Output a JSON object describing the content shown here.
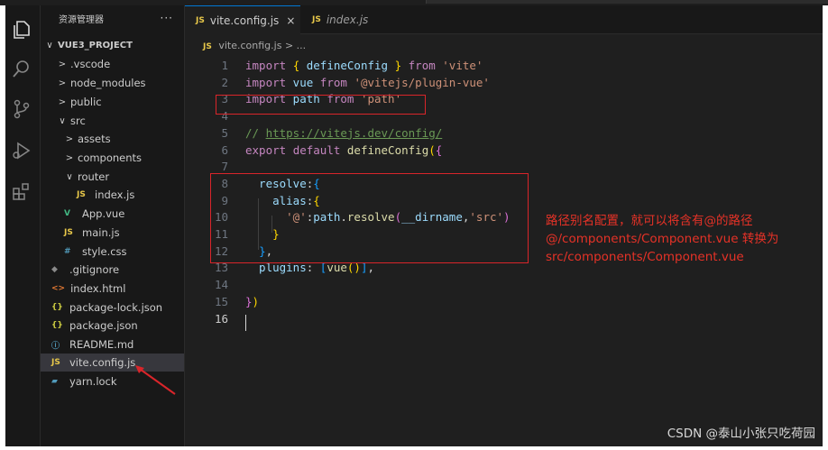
{
  "sidebar": {
    "title": "资源管理器",
    "more": "···",
    "items": [
      {
        "label": "VUE3_PROJECT",
        "chevron": "∨",
        "icon": ""
      },
      {
        "label": ".vscode",
        "chevron": ">",
        "icon": ""
      },
      {
        "label": "node_modules",
        "chevron": ">",
        "icon": ""
      },
      {
        "label": "public",
        "chevron": ">",
        "icon": ""
      },
      {
        "label": "src",
        "chevron": "∨",
        "icon": ""
      },
      {
        "label": "assets",
        "chevron": ">",
        "icon": ""
      },
      {
        "label": "components",
        "chevron": ">",
        "icon": ""
      },
      {
        "label": "router",
        "chevron": "∨",
        "icon": ""
      },
      {
        "label": "index.js",
        "chevron": "",
        "icon": "JS"
      },
      {
        "label": "App.vue",
        "chevron": "",
        "icon": "V"
      },
      {
        "label": "main.js",
        "chevron": "",
        "icon": "JS"
      },
      {
        "label": "style.css",
        "chevron": "",
        "icon": "#"
      },
      {
        "label": ".gitignore",
        "chevron": "",
        "icon": "◆"
      },
      {
        "label": "index.html",
        "chevron": "",
        "icon": "<>"
      },
      {
        "label": "package-lock.json",
        "chevron": "",
        "icon": "{}"
      },
      {
        "label": "package.json",
        "chevron": "",
        "icon": "{}"
      },
      {
        "label": "README.md",
        "chevron": "",
        "icon": "ⓘ"
      },
      {
        "label": "vite.config.js",
        "chevron": "",
        "icon": "JS"
      },
      {
        "label": "yarn.lock",
        "chevron": "",
        "icon": "▰"
      }
    ]
  },
  "tabs": [
    {
      "icon": "JS",
      "label": "vite.config.js",
      "close": "×"
    },
    {
      "icon": "JS",
      "label": "index.js"
    }
  ],
  "breadcrumb": {
    "icon": "JS",
    "file": "vite.config.js",
    "sep": "> ..."
  },
  "code_lines": [
    {
      "n": "1",
      "tokens": [
        {
          "t": "import",
          "c": "kw"
        },
        {
          "t": " ",
          "c": "punc"
        },
        {
          "t": "{",
          "c": "br1"
        },
        {
          "t": " defineConfig ",
          "c": "id"
        },
        {
          "t": "}",
          "c": "br1"
        },
        {
          "t": " ",
          "c": "punc"
        },
        {
          "t": "from",
          "c": "kw"
        },
        {
          "t": " ",
          "c": "punc"
        },
        {
          "t": "'vite'",
          "c": "str"
        }
      ]
    },
    {
      "n": "2",
      "tokens": [
        {
          "t": "import",
          "c": "kw"
        },
        {
          "t": " vue ",
          "c": "id"
        },
        {
          "t": "from",
          "c": "kw"
        },
        {
          "t": " ",
          "c": "punc"
        },
        {
          "t": "'@vitejs/plugin-vue'",
          "c": "str"
        }
      ]
    },
    {
      "n": "3",
      "tokens": [
        {
          "t": "import",
          "c": "kw"
        },
        {
          "t": " path ",
          "c": "id"
        },
        {
          "t": "from",
          "c": "kw"
        },
        {
          "t": " ",
          "c": "punc"
        },
        {
          "t": "'path'",
          "c": "str"
        }
      ]
    },
    {
      "n": "4",
      "tokens": []
    },
    {
      "n": "5",
      "tokens": [
        {
          "t": "// ",
          "c": "cmt"
        },
        {
          "t": "https://vitejs.dev/config/",
          "c": "link"
        }
      ]
    },
    {
      "n": "6",
      "tokens": [
        {
          "t": "export",
          "c": "kw"
        },
        {
          "t": " ",
          "c": "punc"
        },
        {
          "t": "default",
          "c": "kw"
        },
        {
          "t": " ",
          "c": "punc"
        },
        {
          "t": "defineConfig",
          "c": "fn"
        },
        {
          "t": "(",
          "c": "br1"
        },
        {
          "t": "{",
          "c": "br2"
        }
      ]
    },
    {
      "n": "7",
      "tokens": []
    },
    {
      "n": "8",
      "tokens": [
        {
          "t": "  resolve",
          "c": "id"
        },
        {
          "t": ":",
          "c": "punc"
        },
        {
          "t": "{",
          "c": "br3"
        }
      ]
    },
    {
      "n": "9",
      "tokens": [
        {
          "t": "    alias",
          "c": "id"
        },
        {
          "t": ":",
          "c": "punc"
        },
        {
          "t": "{",
          "c": "br1"
        }
      ]
    },
    {
      "n": "10",
      "tokens": [
        {
          "t": "      ",
          "c": "punc"
        },
        {
          "t": "'@'",
          "c": "str"
        },
        {
          "t": ":",
          "c": "punc"
        },
        {
          "t": "path",
          "c": "id"
        },
        {
          "t": ".",
          "c": "punc"
        },
        {
          "t": "resolve",
          "c": "fn"
        },
        {
          "t": "(",
          "c": "br2"
        },
        {
          "t": "__dirname",
          "c": "id"
        },
        {
          "t": ",",
          "c": "punc"
        },
        {
          "t": "'src'",
          "c": "str"
        },
        {
          "t": ")",
          "c": "br2"
        }
      ]
    },
    {
      "n": "11",
      "tokens": [
        {
          "t": "    ",
          "c": "punc"
        },
        {
          "t": "}",
          "c": "br1"
        }
      ]
    },
    {
      "n": "12",
      "tokens": [
        {
          "t": "  ",
          "c": "punc"
        },
        {
          "t": "}",
          "c": "br3"
        },
        {
          "t": ",",
          "c": "punc"
        }
      ]
    },
    {
      "n": "13",
      "tokens": [
        {
          "t": "  plugins",
          "c": "id"
        },
        {
          "t": ": ",
          "c": "punc"
        },
        {
          "t": "[",
          "c": "br3"
        },
        {
          "t": "vue",
          "c": "fn"
        },
        {
          "t": "()",
          "c": "br1"
        },
        {
          "t": "]",
          "c": "br3"
        },
        {
          "t": ",",
          "c": "punc"
        }
      ]
    },
    {
      "n": "14",
      "tokens": []
    },
    {
      "n": "15",
      "tokens": [
        {
          "t": "}",
          "c": "br2"
        },
        {
          "t": ")",
          "c": "br1"
        }
      ]
    },
    {
      "n": "16",
      "tokens": []
    }
  ],
  "annotation": {
    "line1": "路径别名配置，就可以将含有@的路径",
    "line2": "@/components/Component.vue 转换为",
    "line3": "src/components/Component.vue"
  },
  "watermark": "CSDN @泰山小张只吃荷园",
  "colors": {
    "annotation": "#e63227",
    "box": "#d9252a",
    "accent": "#0078d4"
  }
}
